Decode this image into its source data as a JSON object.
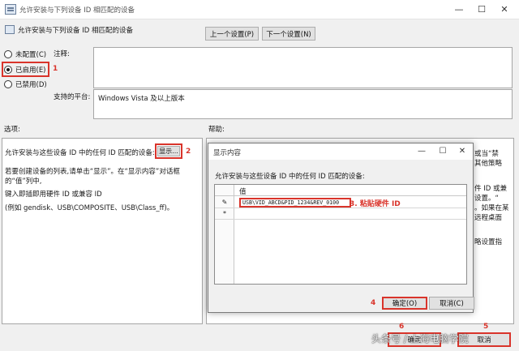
{
  "window": {
    "title": "允许安装与下列设备 ID 相匹配的设备",
    "heading": "允许安装与下列设备 ID 相匹配的设备",
    "controls": {
      "minimize": "—",
      "maximize": "☐",
      "close": "✕"
    }
  },
  "nav": {
    "prev_label": "上一个设置(P)",
    "next_label": "下一个设置(N)"
  },
  "state": {
    "options": [
      {
        "label": "未配置(C)",
        "selected": false
      },
      {
        "label": "已启用(E)",
        "selected": true
      },
      {
        "label": "已禁用(D)",
        "selected": false
      }
    ]
  },
  "comment": {
    "label": "注释:",
    "value": ""
  },
  "platform": {
    "label": "支持的平台:",
    "value": "Windows Vista 及以上版本"
  },
  "options_section": {
    "label": "选项:",
    "line1": "允许安装与这些设备 ID 中的任何 ID 匹配的设备:",
    "show_label": "显示...",
    "desc1": "若要创建设备的列表,请单击“显示”。在“显示内容”对话框",
    "desc2": "的“值”列中,",
    "desc3": "键入即插即用硬件 ID 或兼容 ID",
    "desc4": "(例如 gendisk、USB\\COMPOSITE、USB\\Class_ff)。"
  },
  "help_section": {
    "label": "帮助:",
    "frag1": "或当“禁",
    "frag2": "其他策略",
    "frag3": "件 ID 或兼",
    "frag4": "设置。“",
    "frag5": "。如果在某",
    "frag6": "远程桌面",
    "frag7": "略设置指"
  },
  "dialog": {
    "title": "显示内容",
    "controls": {
      "minimize": "—",
      "maximize": "☐",
      "close": "✕"
    },
    "prompt": "允许安装与这些设备 ID 中的任何 ID 匹配的设备:",
    "column_header": "值",
    "rows": [
      {
        "marker": "✎",
        "value": "USB\\VID_ABCD&PID_1234&REV_0100"
      },
      {
        "marker": "*",
        "value": ""
      }
    ],
    "ok_label": "确定(O)",
    "cancel_label": "取消(C)"
  },
  "footer": {
    "ok_label": "确定",
    "cancel_label": "取消"
  },
  "annotations": {
    "n1": "1",
    "n2": "2",
    "n3": "3. 粘贴硬件 ID",
    "n4": "4",
    "n5": "5",
    "n6": "6"
  },
  "watermark": "头条号 / 上海电脑学院",
  "colors": {
    "highlight_red": "#d9342b",
    "window_bg": "#f0f0f0",
    "button_bg": "#e1e1e1"
  }
}
